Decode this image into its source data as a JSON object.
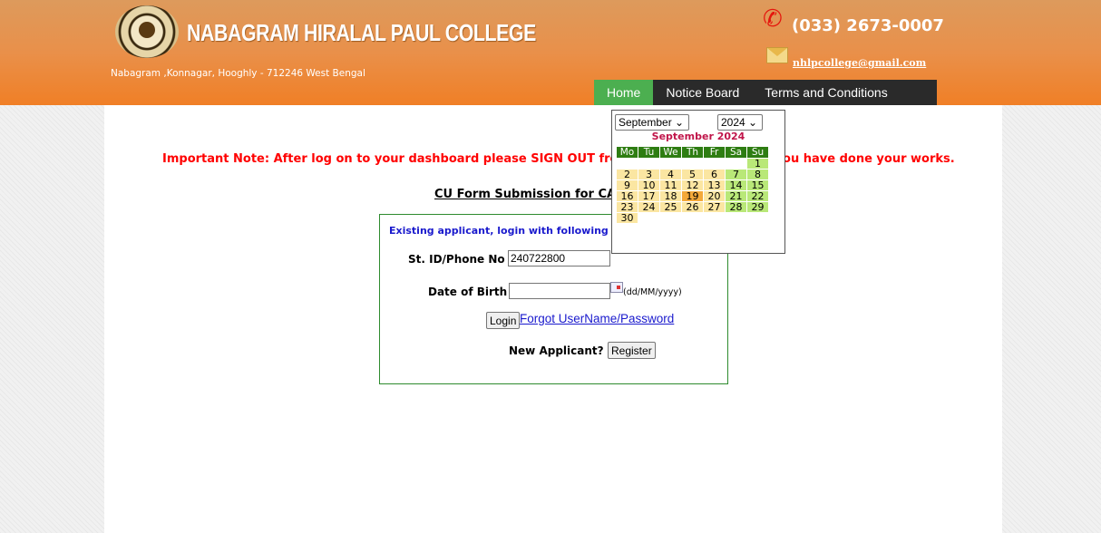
{
  "header": {
    "college_name": "NABAGRAM HIRALAL PAUL COLLEGE",
    "address": "Nabagram ,Konnagar, Hooghly - 712246 West Bengal",
    "phone": "(033) 2673-0007",
    "email": "nhlpcollege@gmail.com",
    "phone_icon_color": "#e5160d",
    "bar_color": "#f07f26"
  },
  "nav": {
    "items": [
      {
        "label": "Home",
        "active": true
      },
      {
        "label": "Notice Board",
        "active": false
      },
      {
        "label": "Terms and Conditions",
        "active": false
      }
    ],
    "active_color": "#4caf50"
  },
  "main": {
    "important_note": "Important Note: After log on to your dashboard please SIGN OUT from the dashboard when you have done your works.",
    "note_color": "#ff0000",
    "form_title": "CU Form Submission for CA"
  },
  "login": {
    "heading": "Existing applicant, login with following details",
    "id_label": "St. ID/Phone No :",
    "id_value": "240722800",
    "dob_label": "Date of Birth :",
    "dob_value": "",
    "dob_hint": "(dd/MM/yyyy)",
    "login_button": "Login",
    "forgot_link": "Forgot UserName/Password",
    "new_applicant_label": "New Applicant?",
    "register_button": "Register"
  },
  "calendar": {
    "month_select": "September",
    "year_select": "2024",
    "title": "September 2024",
    "weekdays": [
      "Mo",
      "Tu",
      "We",
      "Th",
      "Fr",
      "Sa",
      "Su"
    ],
    "weeks": [
      [
        "",
        "",
        "",
        "",
        "",
        "",
        "1"
      ],
      [
        "2",
        "3",
        "4",
        "5",
        "6",
        "7",
        "8"
      ],
      [
        "9",
        "10",
        "11",
        "12",
        "13",
        "14",
        "15"
      ],
      [
        "16",
        "17",
        "18",
        "19",
        "20",
        "21",
        "22"
      ],
      [
        "23",
        "24",
        "25",
        "26",
        "27",
        "28",
        "29"
      ],
      [
        "30",
        "",
        "",
        "",
        "",
        "",
        ""
      ]
    ],
    "today": "19",
    "colors": {
      "header": "#2e7d12",
      "weekday": "#fbe6a2",
      "weekend": "#b9e878",
      "today": "#f4a93a",
      "title": "#c0154a"
    }
  }
}
